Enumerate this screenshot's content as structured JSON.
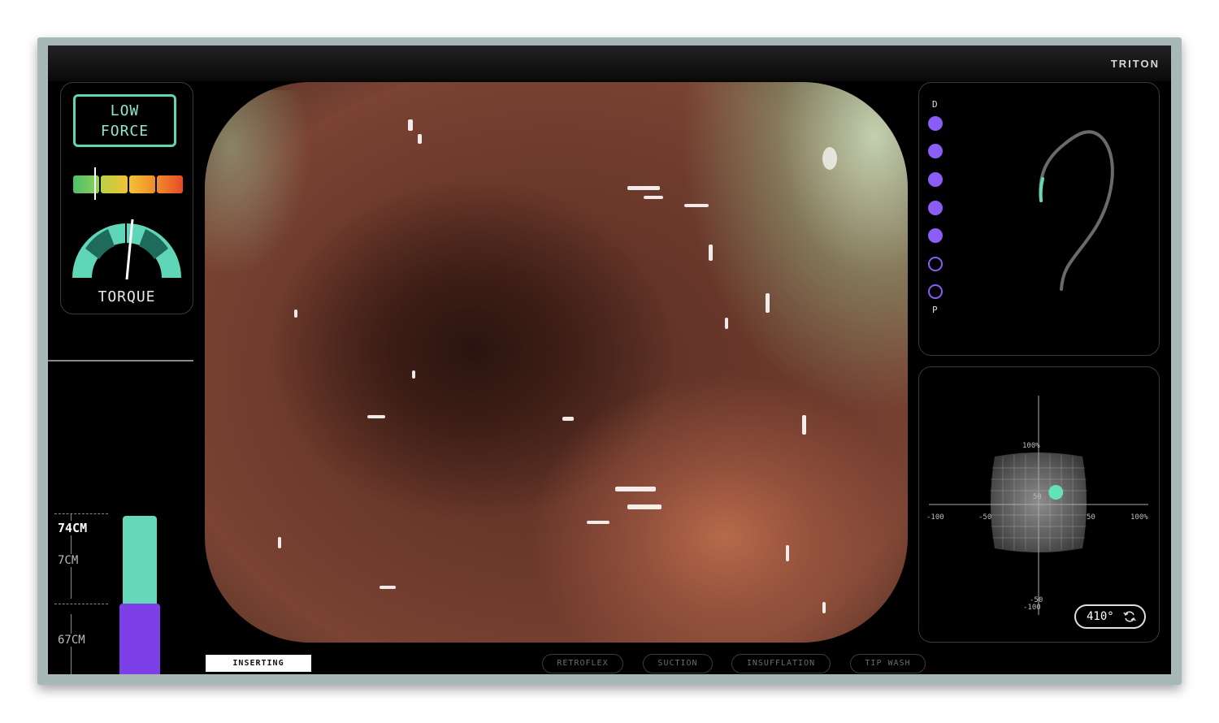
{
  "brand": "TRITON",
  "force": {
    "status_line1": "LOW",
    "status_line2": "FORCE",
    "level": 0.2,
    "colors": [
      "#4cbf6a",
      "#b7d14a",
      "#f2c233",
      "#ee8c2c",
      "#e84a25"
    ]
  },
  "torque": {
    "label": "TORQUE"
  },
  "depth": {
    "current": "74CM",
    "mark1": "7CM",
    "mark2": "67CM"
  },
  "articulation": {
    "top_label": "D",
    "bottom_label": "P",
    "dots": [
      true,
      true,
      true,
      true,
      true,
      false,
      false
    ]
  },
  "joystick": {
    "ticks": {
      "y_top": "100%",
      "y_50": "50",
      "y_neg50": "-50",
      "y_neg100": "-100",
      "x_neg100": "-100",
      "x_neg50": "-50",
      "x_50": "50",
      "x_100": "100%"
    },
    "position": {
      "x": 17,
      "y": 12
    },
    "rotation": "410°"
  },
  "status": {
    "mode": "INSERTING"
  },
  "controls": {
    "retroflex": "RETROFLEX",
    "suction": "SUCTION",
    "insufflation": "INSUFFLATION",
    "tip_wash": "TIP WASH"
  }
}
